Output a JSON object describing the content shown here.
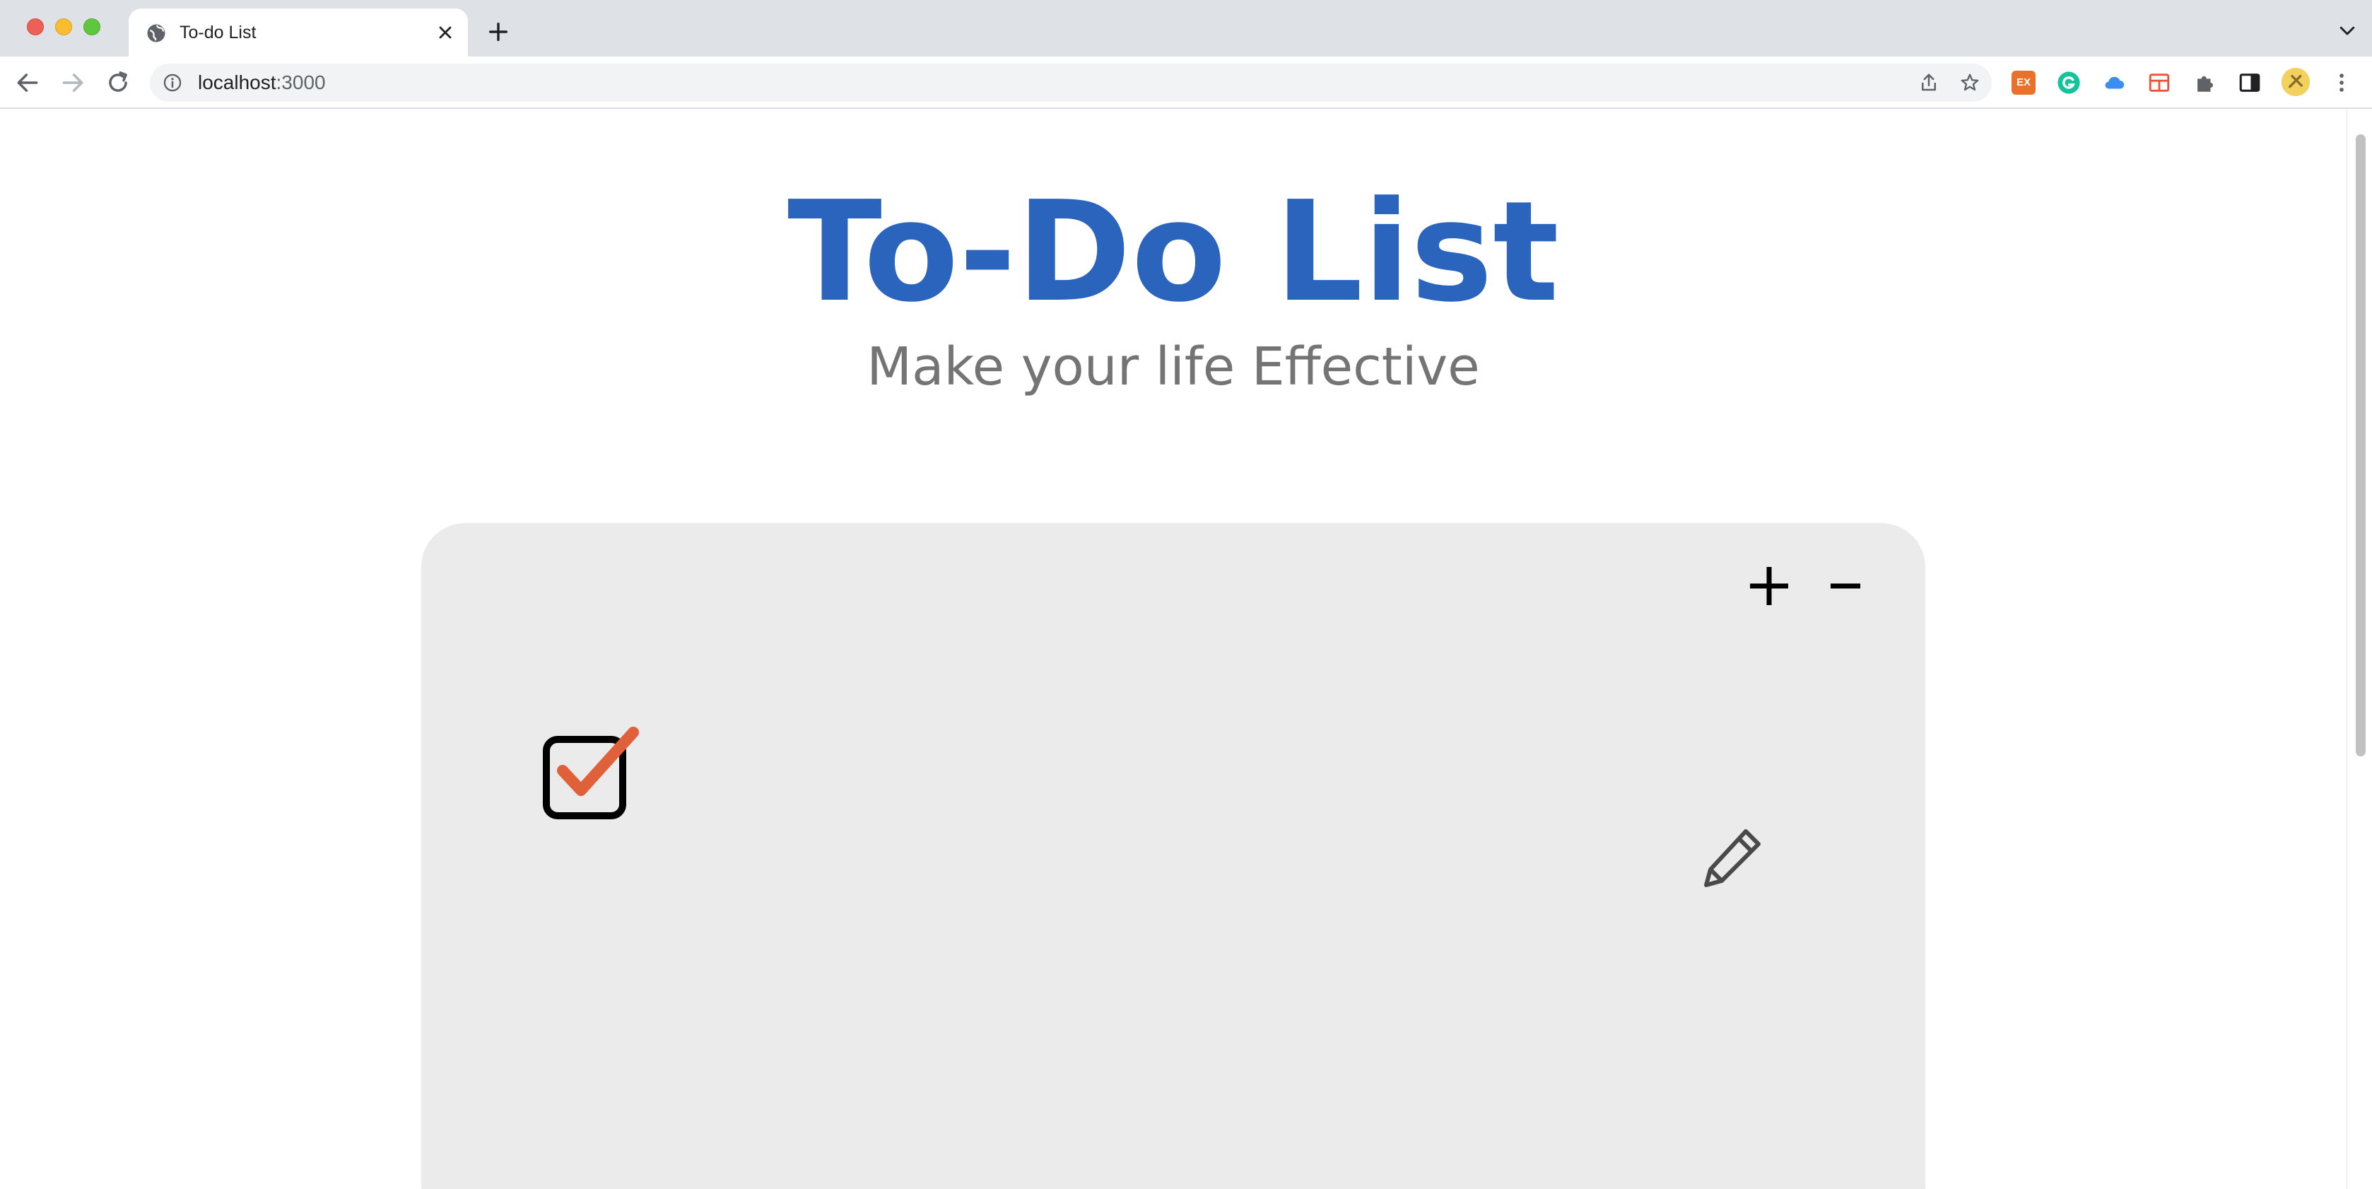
{
  "browser": {
    "tab_title": "To-do List",
    "url_host": "localhost",
    "url_port": ":3000",
    "extensions": {
      "ex_label": "EX"
    }
  },
  "page": {
    "title": "To-Do List",
    "subtitle": "Make your life Effective"
  },
  "todo_card": {
    "items": [
      {
        "text": "",
        "checked": true
      }
    ]
  },
  "colors": {
    "title": "#2b64bd",
    "subtitle": "#747474",
    "card": "#ebebeb",
    "check": "#e0603a"
  }
}
